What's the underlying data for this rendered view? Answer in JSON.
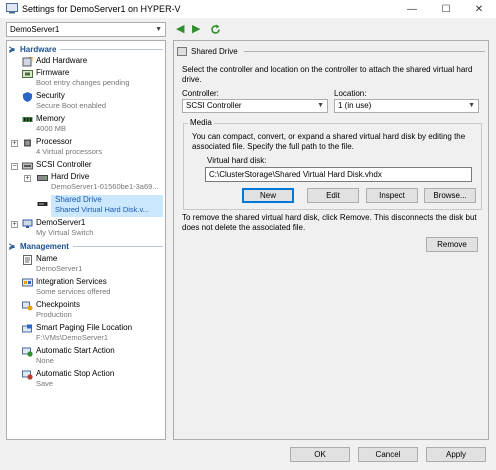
{
  "window": {
    "title": "Settings for DemoServer1 on HYPER-V",
    "minimize": "—",
    "maximize": "☐",
    "close": "✕"
  },
  "server_selector": {
    "value": "DemoServer1"
  },
  "tree": {
    "hardware_header": "Hardware",
    "management_header": "Management",
    "hardware": [
      {
        "label": "Add Hardware",
        "sub": "",
        "icon": "add-hardware-icon"
      },
      {
        "label": "Firmware",
        "sub": "Boot entry changes pending",
        "icon": "firmware-icon"
      },
      {
        "label": "Security",
        "sub": "Secure Boot enabled",
        "icon": "shield-icon"
      },
      {
        "label": "Memory",
        "sub": "4000 MB",
        "icon": "memory-icon"
      },
      {
        "label": "Processor",
        "sub": "4 Virtual processors",
        "icon": "processor-icon"
      },
      {
        "label": "SCSI Controller",
        "sub": "",
        "icon": "scsi-controller-icon"
      },
      {
        "label": "Hard Drive",
        "sub": "DemoServer1-01560be1-3a69...",
        "icon": "hard-drive-icon"
      },
      {
        "label": "Shared Drive",
        "sub": "Shared Virtual Hard Disk.v...",
        "icon": "shared-drive-icon"
      },
      {
        "label": "DemoServer1",
        "sub": "My Virtual Switch",
        "icon": "network-adapter-icon"
      }
    ],
    "management": [
      {
        "label": "Name",
        "sub": "DemoServer1",
        "icon": "name-icon"
      },
      {
        "label": "Integration Services",
        "sub": "Some services offered",
        "icon": "integration-services-icon"
      },
      {
        "label": "Checkpoints",
        "sub": "Production",
        "icon": "checkpoints-icon"
      },
      {
        "label": "Smart Paging File Location",
        "sub": "F:\\VMs\\DemoServer1",
        "icon": "smart-paging-icon"
      },
      {
        "label": "Automatic Start Action",
        "sub": "None",
        "icon": "start-action-icon"
      },
      {
        "label": "Automatic Stop Action",
        "sub": "Save",
        "icon": "stop-action-icon"
      }
    ]
  },
  "panel": {
    "header": "Shared Drive",
    "description": "Select the controller and location on the controller to attach the shared virtual hard drive.",
    "controller_label": "Controller:",
    "controller_value": "SCSI Controller",
    "location_label": "Location:",
    "location_value": "1 (in use)",
    "media_legend": "Media",
    "media_description": "You can compact, convert, or expand a shared virtual hard disk by editing the associated file. Specify the full path to the file.",
    "vhd_label": "Virtual hard disk:",
    "vhd_value": "C:\\ClusterStorage\\Shared Virtual Hard Disk.vhdx",
    "btn_new": "New",
    "btn_edit": "Edit",
    "btn_inspect": "Inspect",
    "btn_browse": "Browse...",
    "remove_text": "To remove the shared virtual hard disk, click Remove. This disconnects the disk but does not delete the associated file.",
    "btn_remove": "Remove"
  },
  "footer": {
    "ok": "OK",
    "cancel": "Cancel",
    "apply": "Apply"
  }
}
